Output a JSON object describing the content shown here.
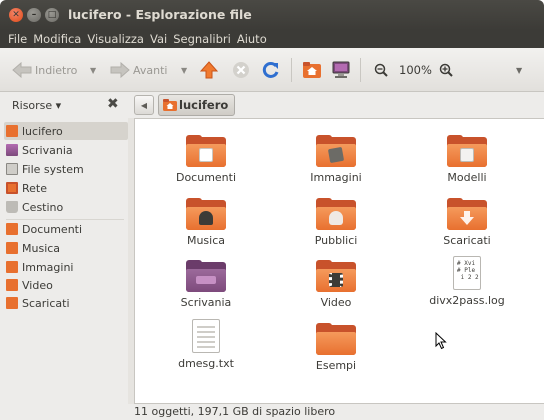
{
  "window": {
    "title": "lucifero - Esplorazione file"
  },
  "menubar": {
    "items": [
      "File",
      "Modifica",
      "Visualizza",
      "Vai",
      "Segnalibri",
      "Aiuto"
    ]
  },
  "toolbar": {
    "back_label": "Indietro",
    "forward_label": "Avanti",
    "zoom_level": "100%"
  },
  "sidepane": {
    "title": "Risorse ▾",
    "items": [
      {
        "label": "lucifero",
        "icon": "home-folder-icon",
        "selected": true
      },
      {
        "label": "Scrivania",
        "icon": "desktop-icon"
      },
      {
        "label": "File system",
        "icon": "harddisk-icon"
      },
      {
        "label": "Rete",
        "icon": "network-icon"
      },
      {
        "label": "Cestino",
        "icon": "trash-icon"
      },
      {
        "label": "Documenti",
        "icon": "documents-folder-icon"
      },
      {
        "label": "Musica",
        "icon": "music-folder-icon"
      },
      {
        "label": "Immagini",
        "icon": "pictures-folder-icon"
      },
      {
        "label": "Video",
        "icon": "video-folder-icon"
      },
      {
        "label": "Scaricati",
        "icon": "downloads-folder-icon"
      }
    ]
  },
  "location": {
    "crumb": "lucifero"
  },
  "files": [
    {
      "label": "Documenti",
      "icon": "documents-folder-icon"
    },
    {
      "label": "Immagini",
      "icon": "pictures-folder-icon"
    },
    {
      "label": "Modelli",
      "icon": "templates-folder-icon"
    },
    {
      "label": "Musica",
      "icon": "music-folder-icon"
    },
    {
      "label": "Pubblici",
      "icon": "public-folder-icon"
    },
    {
      "label": "Scaricati",
      "icon": "downloads-folder-icon"
    },
    {
      "label": "Scrivania",
      "icon": "desktop-folder-icon"
    },
    {
      "label": "Video",
      "icon": "video-folder-icon"
    },
    {
      "label": "divx2pass.log",
      "icon": "text-file-icon",
      "preview": "# Xvi\n# Ple\n i 2 2"
    },
    {
      "label": "dmesg.txt",
      "icon": "text-file-icon"
    },
    {
      "label": "Esempi",
      "icon": "examples-folder-icon"
    }
  ],
  "statusbar": {
    "text": "11 oggetti, 197,1 GB di spazio libero"
  },
  "colors": {
    "titlebar": "#3c3b37",
    "folder_orange": "#e8702f",
    "selection": "#d6d3cd"
  }
}
